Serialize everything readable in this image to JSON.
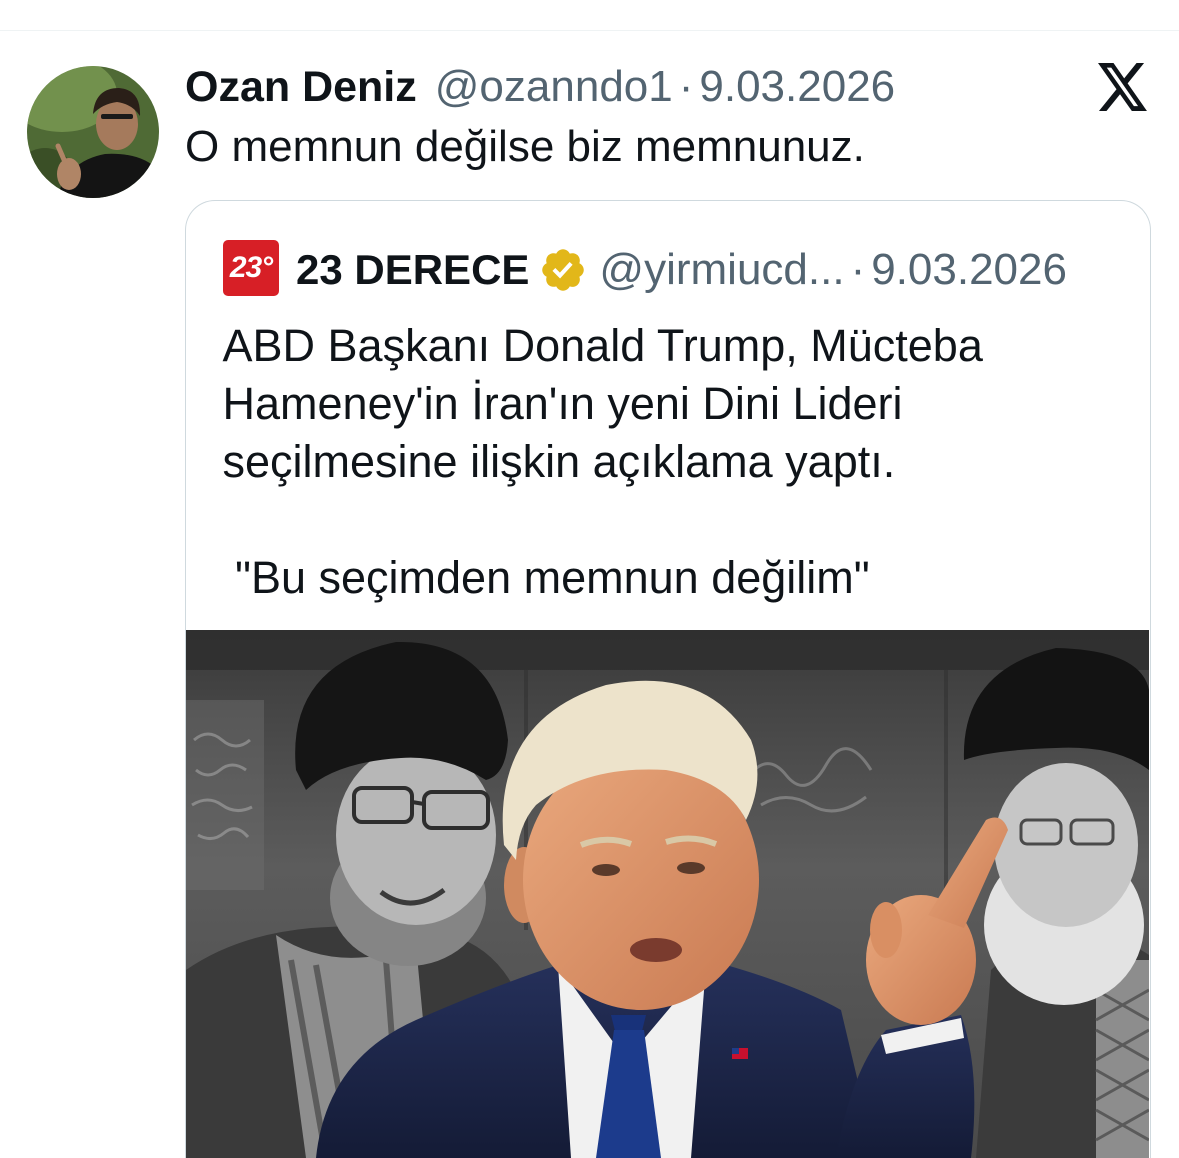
{
  "colors": {
    "text": "#0f1419",
    "secondary": "#536471",
    "border": "#cfd9de",
    "brand_red": "#d71f26",
    "verified_gold": "#e2b719"
  },
  "icons": {
    "platform": "x-logo-icon",
    "verified": "verified-badge-icon"
  },
  "tweet": {
    "author": {
      "name": "Ozan Deniz",
      "handle": "@ozanndo1",
      "separator": "·",
      "date": "9.03.2026"
    },
    "text": "O memnun değilse biz memnunuz."
  },
  "quote": {
    "author": {
      "logo_text": "23°",
      "name": "23 DERECE",
      "verified": true,
      "handle": "@yirmiucd...",
      "separator": "·",
      "date": "9.03.2026"
    },
    "paragraphs": [
      [
        "ABD Başkanı Donald Trump, Mücteba",
        "Hameney'in İran'ın yeni Dini Lideri",
        "seçilmesine ilişkin açıklama yaptı."
      ],
      [
        " \"Bu seçimden memnun değilim\""
      ]
    ]
  }
}
